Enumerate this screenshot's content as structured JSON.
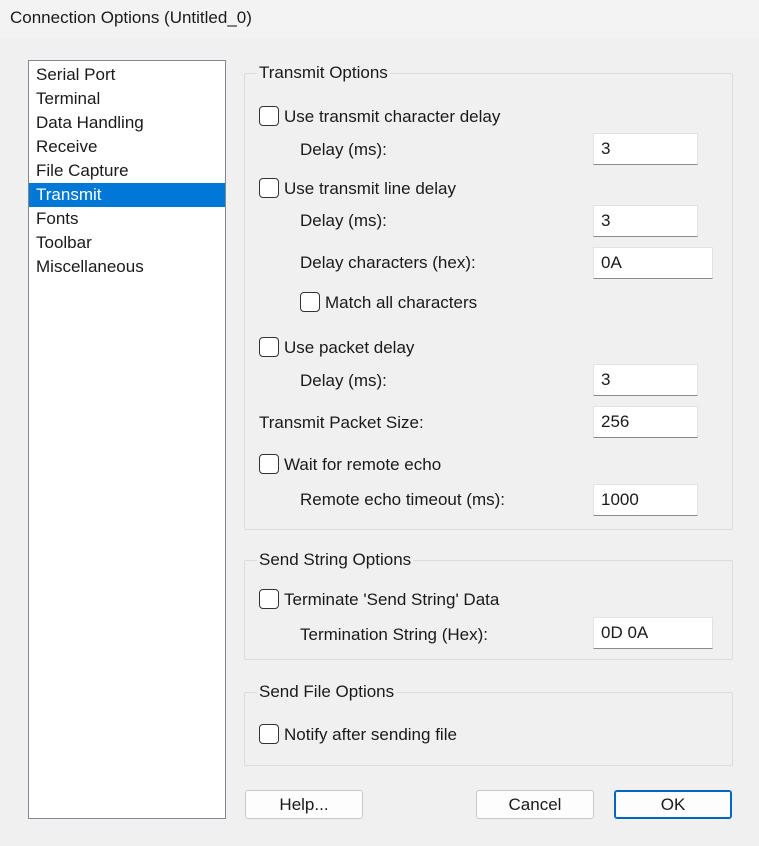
{
  "window": {
    "title": "Connection Options (Untitled_0)"
  },
  "nav": {
    "items": [
      "Serial Port",
      "Terminal",
      "Data Handling",
      "Receive",
      "File Capture",
      "Transmit",
      "Fonts",
      "Toolbar",
      "Miscellaneous"
    ],
    "selected": "Transmit"
  },
  "transmit": {
    "legend": "Transmit Options",
    "char_delay": {
      "checkbox_label": "Use transmit character delay",
      "checked": false,
      "delay_label": "Delay (ms):",
      "delay_value": "3"
    },
    "line_delay": {
      "checkbox_label": "Use transmit line delay",
      "checked": false,
      "delay_label": "Delay (ms):",
      "delay_value": "3",
      "chars_label": "Delay characters (hex):",
      "chars_value": "0A",
      "match_label": "Match all characters",
      "match_checked": false
    },
    "packet_delay": {
      "checkbox_label": "Use packet delay",
      "checked": false,
      "delay_label": "Delay (ms):",
      "delay_value": "3"
    },
    "packet_size": {
      "label": "Transmit Packet Size:",
      "value": "256"
    },
    "remote_echo": {
      "checkbox_label": "Wait for remote echo",
      "checked": false,
      "timeout_label": "Remote echo timeout (ms):",
      "timeout_value": "1000"
    }
  },
  "send_string": {
    "legend": "Send String Options",
    "checkbox_label": "Terminate 'Send String' Data",
    "checked": false,
    "termination_label": "Termination String (Hex):",
    "termination_value": "0D 0A"
  },
  "send_file": {
    "legend": "Send File Options",
    "checkbox_label": "Notify after sending file",
    "checked": false
  },
  "buttons": {
    "help": "Help...",
    "cancel": "Cancel",
    "ok": "OK"
  },
  "colors": {
    "selection": "#0078d7",
    "default_button_border": "#0067c0",
    "background": "#f0f0f0"
  }
}
